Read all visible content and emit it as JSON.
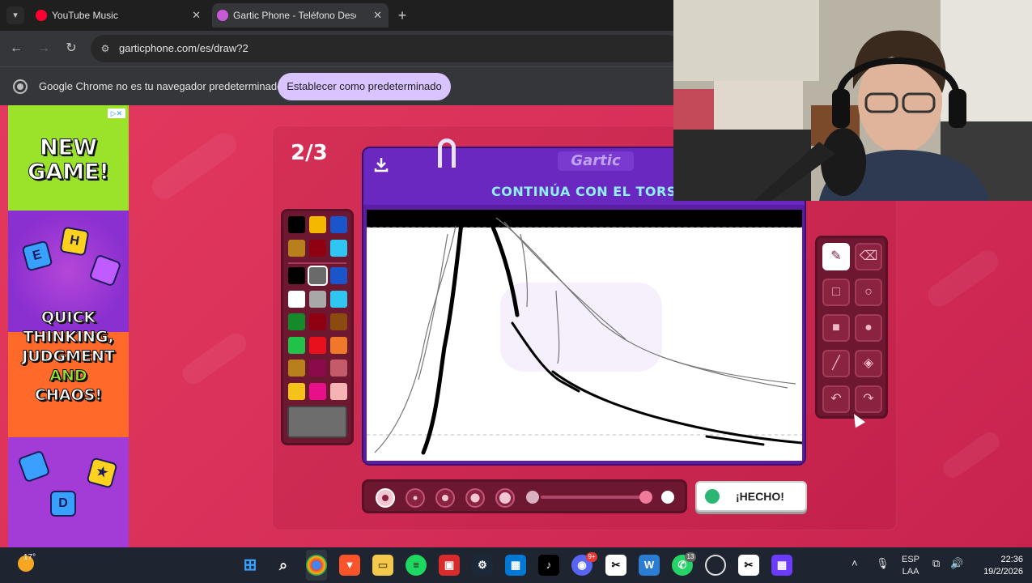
{
  "browser": {
    "tabs": [
      {
        "title": "YouTube Music",
        "active": false
      },
      {
        "title": "Gartic Phone - Teléfono Descon",
        "active": true
      }
    ],
    "url": "garticphone.com/es/draw?2",
    "infobar": {
      "message": "Google Chrome no es tu navegador predeterminado",
      "button": "Establecer como predeterminado"
    }
  },
  "ad": {
    "headline": "NEW GAME!",
    "headline_line1": "NEW",
    "headline_line2": "GAME!",
    "tagline": [
      "QUICK",
      "THINKING,",
      "JUDGMENT",
      "AND",
      "CHAOS!"
    ],
    "dice": [
      "H",
      "E",
      "D"
    ]
  },
  "game": {
    "round": "2/3",
    "brand": "Gartic",
    "task": "CONTINÚA CON EL TORSO",
    "palette": [
      "#000000",
      "#f5b800",
      "#1a56c9",
      "#b8801c",
      "#8f0012",
      "#30c6f2",
      "#000000",
      "#6a6a6a",
      "#1a56c9",
      "#ffffff",
      "#a8a8a8",
      "#30c6f2",
      "#148a2a",
      "#8f0012",
      "#8a4a10",
      "#22c24a",
      "#e8101c",
      "#f0782a",
      "#b8801c",
      "#8a0a4a",
      "#c45a6a",
      "#f5c21a",
      "#e8108a",
      "#f6b3b3"
    ],
    "selected_color": "#6a6a6a",
    "tools": [
      "pencil-tool",
      "eraser-tool",
      "rectangle-tool",
      "ellipse-tool",
      "filled-rectangle-tool",
      "filled-ellipse-tool",
      "line-tool",
      "fill-tool",
      "undo-tool",
      "redo-tool"
    ],
    "active_tool": "pencil-tool",
    "brush_sizes": 5,
    "selected_brush_size": 1,
    "opacity_level": 1.0,
    "done_button": "¡HECHO!"
  },
  "taskbar": {
    "temperature": "17°",
    "lang_1": "ESP",
    "lang_2": "LAA",
    "time": "22:36",
    "date": "19/2/2026",
    "badges": {
      "discord": "9+",
      "whatsapp": "13"
    }
  },
  "colors": {
    "page_bg": "#d9315a",
    "board_purple": "#5b1ea3",
    "task_text": "#8ff0ff",
    "infobar_button": "#d9c4ff"
  }
}
